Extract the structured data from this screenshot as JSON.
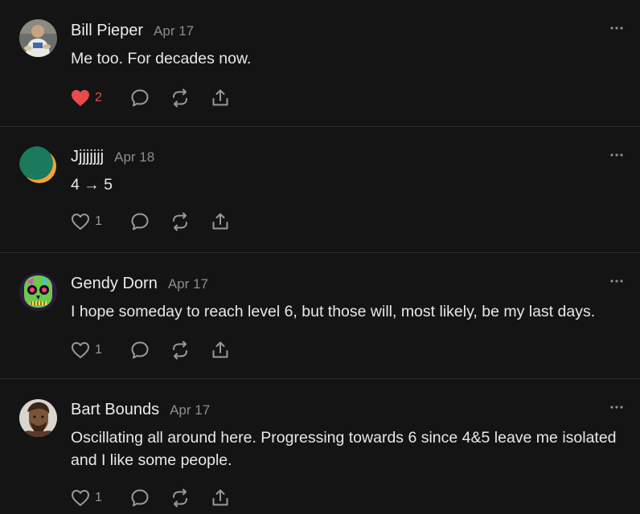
{
  "comments": [
    {
      "author": "Bill Pieper",
      "date": "Apr 17",
      "text": "Me too. For decades now.",
      "likes": "2",
      "liked": true,
      "avatar_icon": "person-photo-avatar"
    },
    {
      "author": "Jjjjjjjj",
      "date": "Apr 18",
      "text": "4 → 5",
      "likes": "1",
      "liked": false,
      "avatar_icon": "green-orange-circle-avatar"
    },
    {
      "author": "Gendy Dorn",
      "date": "Apr 17",
      "text": "I hope someday to reach level 6, but those will, most likely, be my last days.",
      "likes": "1",
      "liked": false,
      "avatar_icon": "neon-skull-avatar"
    },
    {
      "author": "Bart Bounds",
      "date": "Apr 17",
      "text": "Oscillating all around here. Progressing towards 6 since 4&5 leave me isolated and I like some people.",
      "likes": "1",
      "liked": false,
      "avatar_icon": "bearded-man-avatar"
    }
  ],
  "icons": {
    "like": "heart-icon",
    "reply": "comment-bubble-icon",
    "restack": "restack-icon",
    "share": "share-icon",
    "more": "more-options-icon"
  },
  "colors": {
    "background": "#141414",
    "text": "#ececec",
    "muted": "#8d8d8d",
    "liked": "#e94b4b",
    "divider": "#2c2c2c"
  }
}
